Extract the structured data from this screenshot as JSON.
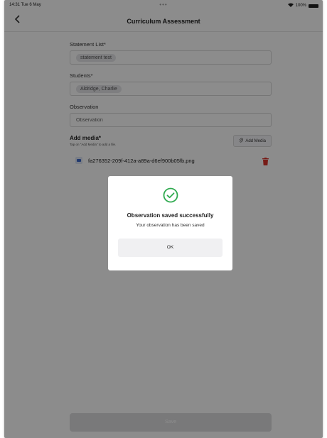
{
  "status_bar": {
    "time": "14:31",
    "date": "Tue 6 May",
    "battery": "100%"
  },
  "nav": {
    "title": "Curriculum Assessment"
  },
  "form": {
    "statement_label": "Statement List*",
    "statement_chip": "statement test",
    "students_label": "Students*",
    "students_chip": "Aldridge, Charlie",
    "observation_label": "Observation",
    "observation_placeholder": "Observation",
    "media_title": "Add media*",
    "media_hint": "Tap on \"Add Media\" to add a file.",
    "add_media_label": "Add Media",
    "file_name": "fa276352-209f-412a-a89a-d6ef900b05fb.png"
  },
  "save_label": "Save",
  "dialog": {
    "title": "Observation saved successfully",
    "message": "Your observation has been saved",
    "ok_label": "OK"
  },
  "colors": {
    "success": "#2faa4f",
    "danger": "#d9342b",
    "overlay": "rgba(0,0,0,0.45)"
  },
  "icons": [
    "back-chevron-icon",
    "wifi-icon",
    "battery-icon",
    "paperclip-icon",
    "image-file-icon",
    "trash-icon",
    "check-circle-icon"
  ]
}
